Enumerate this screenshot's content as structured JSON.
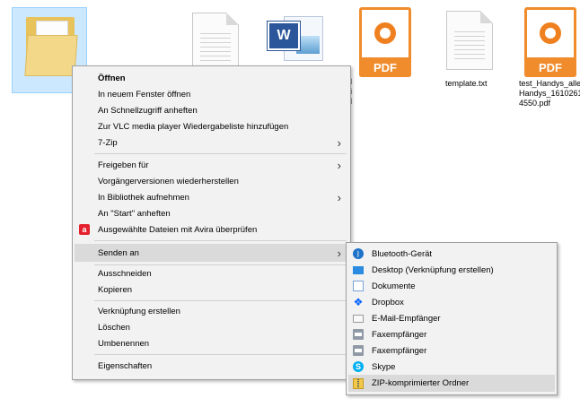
{
  "files": {
    "template_name": "template.txt",
    "pdf_name_line1": "test_Handys_alle",
    "pdf_name_line2": "Handys_1610261",
    "pdf_name_line3": "4550.pdf",
    "partial_line1": "l",
    "partial_line2": "i",
    "partial_line3": "l",
    "word_badge": "W",
    "pdf_label": "PDF"
  },
  "context_menu": {
    "items": [
      {
        "label": "Öffnen"
      },
      {
        "label": "In neuem Fenster öffnen"
      },
      {
        "label": "An Schnellzugriff anheften"
      },
      {
        "label": "Zur VLC media player Wiedergabeliste hinzufügen"
      },
      {
        "label": "7-Zip"
      },
      {
        "label": "Freigeben für"
      },
      {
        "label": "Vorgängerversionen wiederherstellen"
      },
      {
        "label": "In Bibliothek aufnehmen"
      },
      {
        "label": "An \"Start\" anheften"
      },
      {
        "label": "Ausgewählte Dateien mit Avira überprüfen"
      },
      {
        "label": "Senden an"
      },
      {
        "label": "Ausschneiden"
      },
      {
        "label": "Kopieren"
      },
      {
        "label": "Verknüpfung erstellen"
      },
      {
        "label": "Löschen"
      },
      {
        "label": "Umbenennen"
      },
      {
        "label": "Eigenschaften"
      }
    ],
    "submenu_arrow": "›"
  },
  "send_to_menu": {
    "items": [
      {
        "label": "Bluetooth-Gerät",
        "icon": "bluetooth-icon"
      },
      {
        "label": "Desktop (Verknüpfung erstellen)",
        "icon": "desktop-icon"
      },
      {
        "label": "Dokumente",
        "icon": "documents-icon"
      },
      {
        "label": "Dropbox",
        "icon": "dropbox-icon"
      },
      {
        "label": "E-Mail-Empfänger",
        "icon": "mail-icon"
      },
      {
        "label": "Faxempfänger",
        "icon": "fax-icon"
      },
      {
        "label": "Faxempfänger",
        "icon": "fax-icon"
      },
      {
        "label": "Skype",
        "icon": "skype-icon"
      },
      {
        "label": "ZIP-komprimierter Ordner",
        "icon": "zip-folder-icon"
      }
    ]
  },
  "colors": {
    "selection": "#cce8ff",
    "menu_background": "#f2f2f2",
    "menu_highlight": "#dadada",
    "pdf_orange": "#f08c2c"
  }
}
